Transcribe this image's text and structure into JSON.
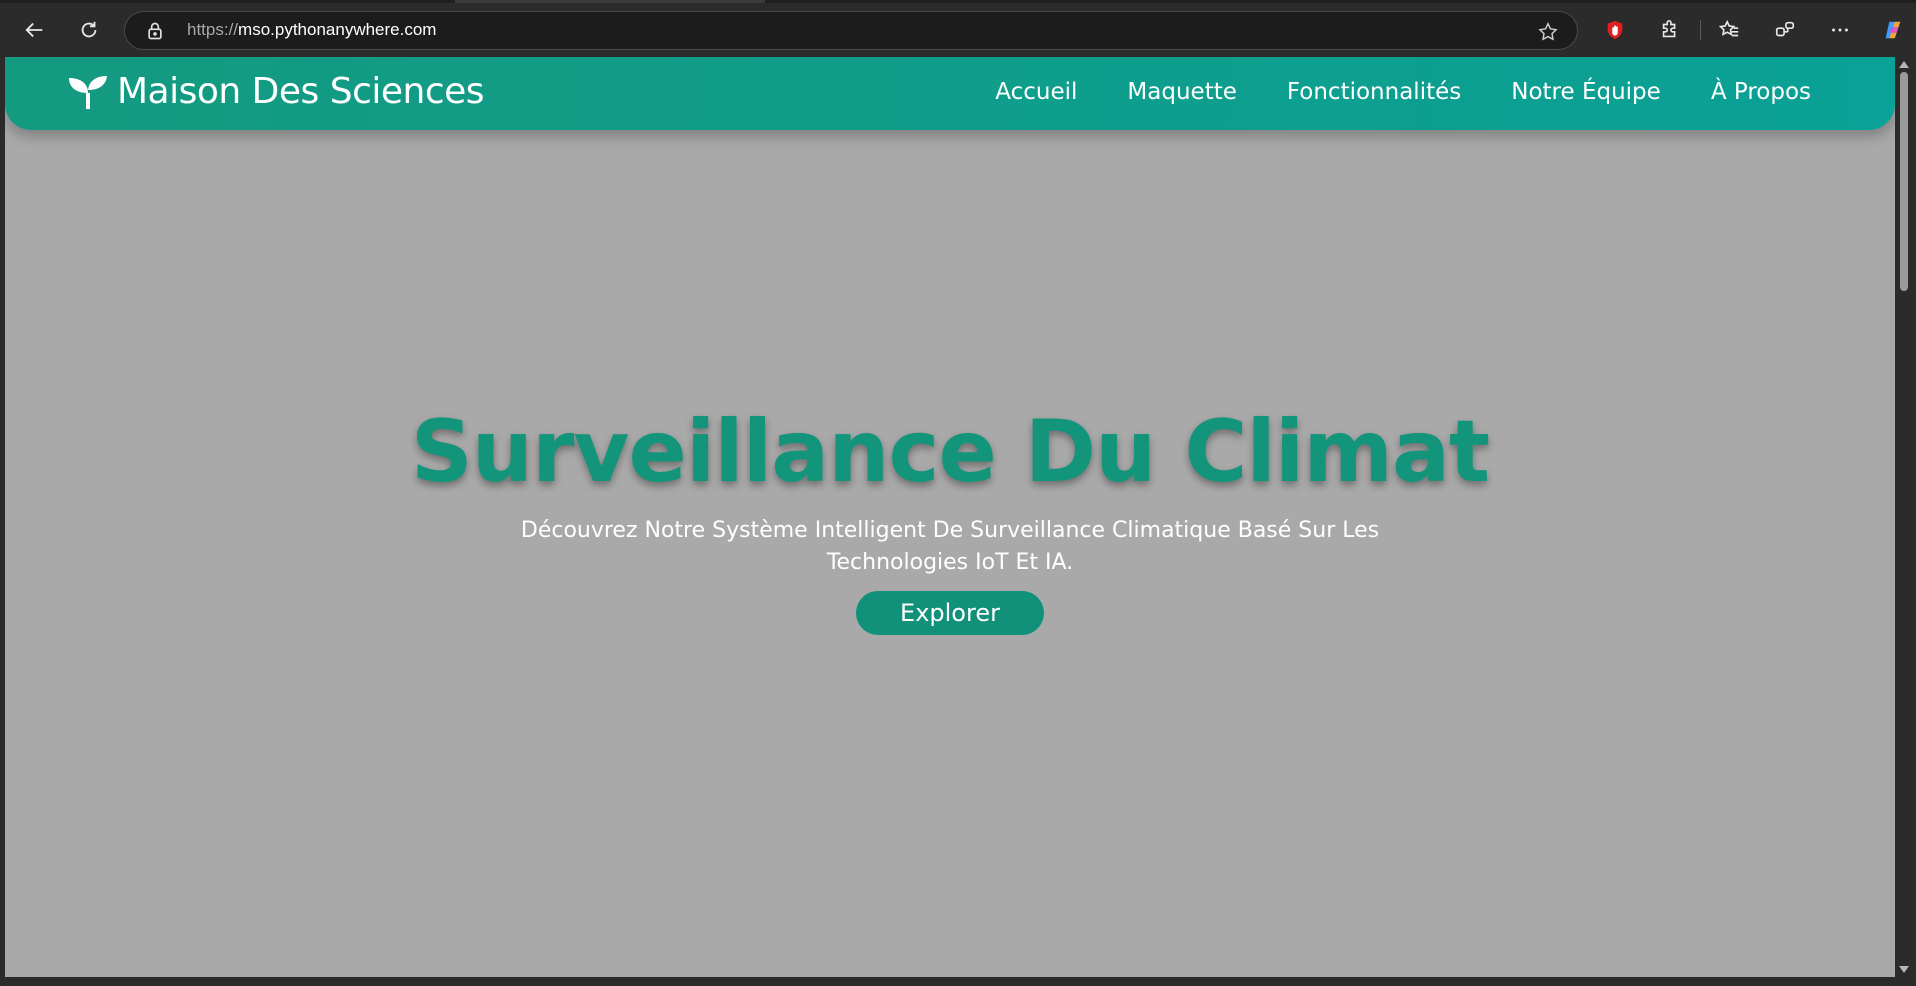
{
  "browser": {
    "url_scheme": "https://",
    "url_host": "mso.pythonanywhere.com",
    "icons": [
      "back-arrow-icon",
      "refresh-icon",
      "lock-icon",
      "star-icon",
      "shield-hand-icon",
      "extensions-puzzle-icon",
      "favorites-icon",
      "collections-icon",
      "more-dots-icon",
      "copilot-icon"
    ]
  },
  "nav": {
    "brand": "Maison Des Sciences",
    "links": [
      "Accueil",
      "Maquette",
      "Fonctionnalités",
      "Notre Équipe",
      "À Propos"
    ]
  },
  "hero": {
    "title": "Surveillance Du Climat",
    "subtitle": "Découvrez Notre Système Intelligent De Surveillance Climatique Basé Sur Les Technologies IoT Et IA.",
    "button": "Explorer"
  },
  "colors": {
    "accent": "#13957c",
    "nav_gradient_start": "#149a80",
    "nav_gradient_end": "#0aa196",
    "hero_background": "#a9a9a9"
  }
}
